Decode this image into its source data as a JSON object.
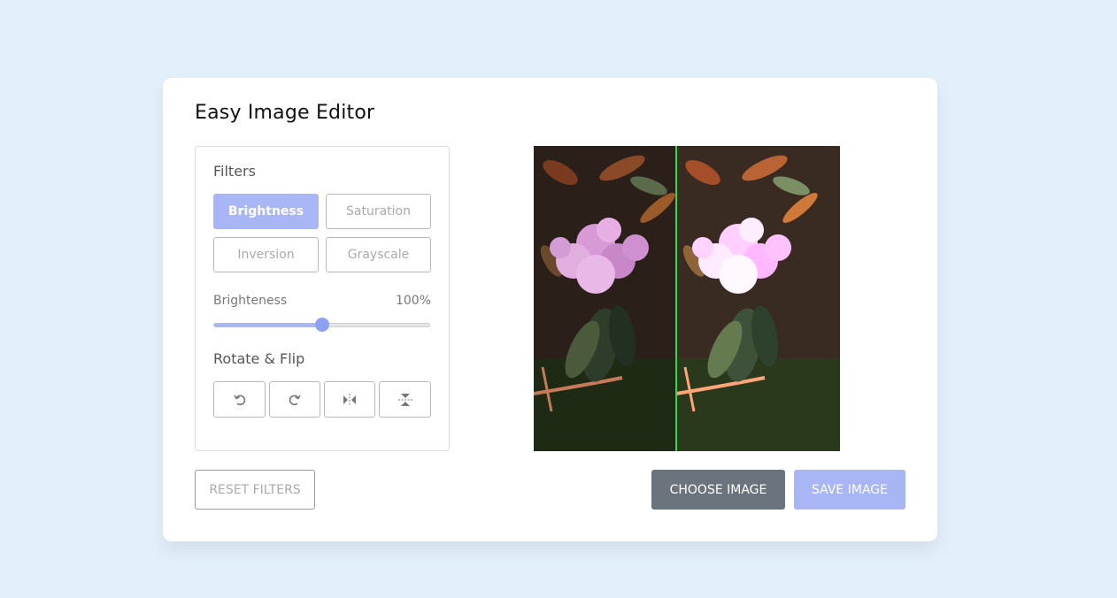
{
  "app": {
    "title": "Easy Image Editor"
  },
  "filters": {
    "heading": "Filters",
    "options": [
      {
        "label": "Brightness",
        "active": true
      },
      {
        "label": "Saturation",
        "active": false
      },
      {
        "label": "Inversion",
        "active": false
      },
      {
        "label": "Grayscale",
        "active": false
      }
    ]
  },
  "slider": {
    "label": "Brighteness",
    "value_text": "100%",
    "position_fraction": 0.5
  },
  "rotate": {
    "heading": "Rotate & Flip",
    "icons": [
      "rotate-left-icon",
      "rotate-right-icon",
      "flip-horizontal-icon",
      "flip-vertical-icon"
    ]
  },
  "buttons": {
    "reset": "RESET FILTERS",
    "choose": "CHOOSE IMAGE",
    "save": "SAVE IMAGE"
  },
  "preview": {
    "image": "flower-photo",
    "comparison": "before-after"
  },
  "colors": {
    "accent": "#a9b6f6",
    "background": "#e3f0fc",
    "choose_button": "#6b747d",
    "divider": "#39d34a"
  }
}
